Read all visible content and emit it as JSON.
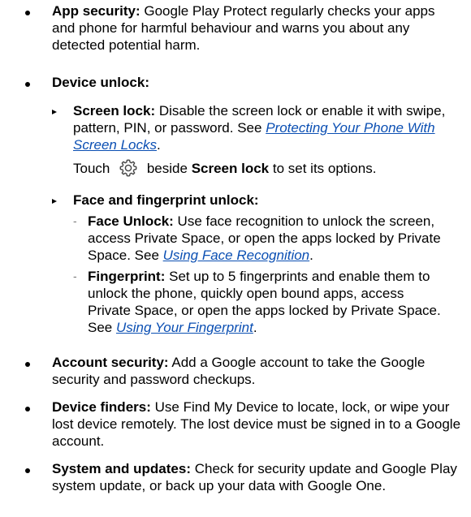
{
  "app_security": {
    "title": "App security:",
    "text": "Google Play Protect regularly checks your apps and phone for harmful behaviour and warns you about any detected potential harm."
  },
  "device_unlock": {
    "title": "Device unlock:",
    "screen_lock": {
      "title": "Screen lock:",
      "text": "Disable the screen lock or enable it with swipe, pattern, PIN, or password. See",
      "link": "Protecting Your Phone With Screen Locks",
      "after": "."
    },
    "touch_note": {
      "before": "Touch",
      "icon": "gear-icon",
      "after": "beside",
      "bold": "Screen lock",
      "end": "to set its options."
    },
    "face_fingerprint": {
      "title": "Face and fingerprint unlock:",
      "face": {
        "title": "Face Unlock:",
        "text": "Use face recognition to unlock the screen, access Private Space, or open the apps locked by Private Space. See",
        "link": "Using Face Recognition",
        "after": "."
      },
      "fingerprint": {
        "title": "Fingerprint:",
        "text": "Set up to 5 fingerprints and enable them to unlock the phone, quickly open bound apps, access Private Space, or open the apps locked by Private Space. See",
        "link": "Using Your Fingerprint",
        "after": "."
      }
    }
  },
  "account_security": {
    "title": "Account security:",
    "text": "Add a Google account to take the Google security and password checkups."
  },
  "device_finders": {
    "title": "Device finders:",
    "text": "Use Find My Device to locate, lock, or wipe your lost device remotely. The lost device must be signed in to a Google account."
  },
  "system_updates": {
    "title": "System and updates:",
    "text": "Check for security update and Google Play system update, or back up your data with Google One."
  },
  "colors": {
    "link": "#0b4fb3",
    "text": "#000000"
  }
}
